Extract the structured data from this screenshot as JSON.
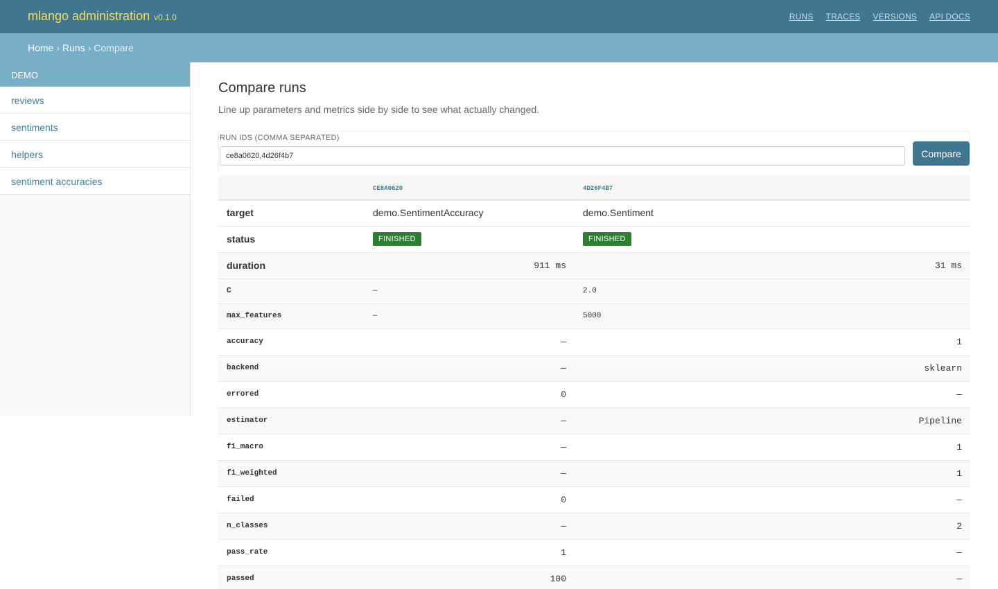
{
  "header": {
    "brand": "mlango administration",
    "version": "v0.1.0",
    "nav": [
      "RUNS",
      "TRACES",
      "VERSIONS",
      "API DOCS"
    ]
  },
  "breadcrumb": {
    "home": "Home",
    "runs": "Runs",
    "current": "Compare"
  },
  "sidebar": {
    "section": "DEMO",
    "items": [
      "reviews",
      "sentiments",
      "helpers",
      "sentiment accuracies"
    ]
  },
  "main": {
    "title": "Compare runs",
    "subtitle": "Line up parameters and metrics side by side to see what actually changed.",
    "form": {
      "label": "RUN IDS (COMMA SEPARATED)",
      "value": "ce8a0620,4d26f4b7",
      "button": "Compare"
    },
    "table": {
      "columns": [
        "",
        "CE8A0620",
        "4D26F4B7"
      ],
      "target": {
        "label": "target",
        "a": "demo.SentimentAccuracy",
        "b": "demo.Sentiment"
      },
      "status": {
        "label": "status",
        "a": "FINISHED",
        "b": "FINISHED"
      },
      "duration": {
        "label": "duration",
        "a": "911 ms",
        "b": "31 ms"
      },
      "params": [
        {
          "label": "C",
          "a": "—",
          "b": "2.0"
        },
        {
          "label": "max_features",
          "a": "—",
          "b": "5000"
        }
      ],
      "metrics": [
        {
          "label": "accuracy",
          "a": "—",
          "b": "1"
        },
        {
          "label": "backend",
          "a": "—",
          "b": "sklearn"
        },
        {
          "label": "errored",
          "a": "0",
          "b": "—"
        },
        {
          "label": "estimator",
          "a": "—",
          "b": "Pipeline"
        },
        {
          "label": "f1_macro",
          "a": "—",
          "b": "1"
        },
        {
          "label": "f1_weighted",
          "a": "—",
          "b": "1"
        },
        {
          "label": "failed",
          "a": "0",
          "b": "—"
        },
        {
          "label": "n_classes",
          "a": "—",
          "b": "2"
        },
        {
          "label": "pass_rate",
          "a": "1",
          "b": "—"
        },
        {
          "label": "passed",
          "a": "100",
          "b": "—"
        }
      ]
    }
  }
}
